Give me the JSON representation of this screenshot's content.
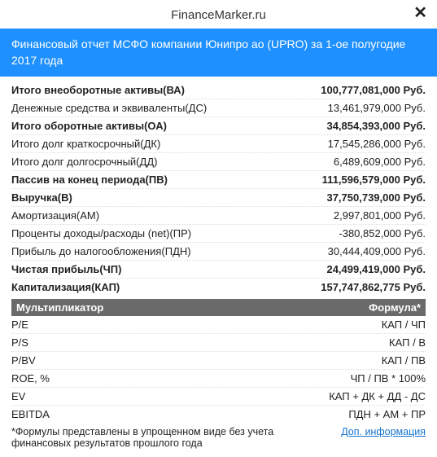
{
  "header": {
    "site_title": "FinanceMarker.ru",
    "close_label": "✕"
  },
  "banner": "Финансовый отчет МСФО компании Юнипро ао (UPRO) за 1-ое полугодие 2017 года",
  "rows": [
    {
      "label": "Итого внеоборотные активы(ВА)",
      "value": "100,777,081,000 Руб.",
      "bold": true
    },
    {
      "label": "Денежные средства и эквиваленты(ДС)",
      "value": "13,461,979,000 Руб.",
      "bold": false
    },
    {
      "label": "Итого оборотные активы(ОА)",
      "value": "34,854,393,000 Руб.",
      "bold": true
    },
    {
      "label": "Итого долг краткосрочный(ДК)",
      "value": "17,545,286,000 Руб.",
      "bold": false
    },
    {
      "label": "Итого долг долгосрочный(ДД)",
      "value": "6,489,609,000 Руб.",
      "bold": false
    },
    {
      "label": "Пассив на конец периода(ПВ)",
      "value": "111,596,579,000 Руб.",
      "bold": true
    },
    {
      "label": "Выручка(В)",
      "value": "37,750,739,000 Руб.",
      "bold": true
    },
    {
      "label": "Амортизация(АМ)",
      "value": "2,997,801,000 Руб.",
      "bold": false
    },
    {
      "label": "Проценты доходы/расходы (net)(ПР)",
      "value": "-380,852,000 Руб.",
      "bold": false
    },
    {
      "label": "Прибыль до налогообложения(ПДН)",
      "value": "30,444,409,000 Руб.",
      "bold": false
    },
    {
      "label": "Чистая прибыль(ЧП)",
      "value": "24,499,419,000 Руб.",
      "bold": true
    },
    {
      "label": "Капитализация(КАП)",
      "value": "157,747,862,775 Руб.",
      "bold": true
    }
  ],
  "multipliers_header": {
    "left": "Мультипликатор",
    "right": "Формула*"
  },
  "multipliers": [
    {
      "label": "P/E",
      "value": "КАП / ЧП"
    },
    {
      "label": "P/S",
      "value": "КАП / В"
    },
    {
      "label": "P/BV",
      "value": "КАП / ПВ"
    },
    {
      "label": "ROE, %",
      "value": "ЧП / ПВ * 100%"
    },
    {
      "label": "EV",
      "value": "КАП + ДК + ДД - ДС"
    },
    {
      "label": "EBITDA",
      "value": "ПДН + АМ + ПР"
    }
  ],
  "footnote": {
    "note": "*Формулы представлены в упрощенном виде без учета финансовых результатов прошлого года",
    "link": "Доп. информация"
  }
}
